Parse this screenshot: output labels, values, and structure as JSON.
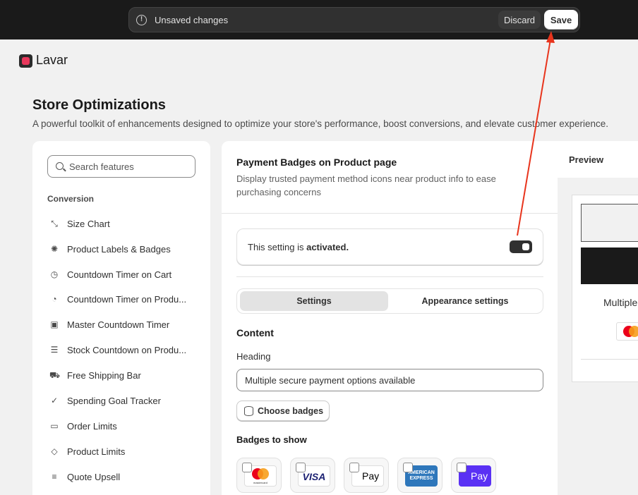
{
  "topbar": {
    "unsaved_text": "Unsaved changes",
    "discard_label": "Discard",
    "save_label": "Save"
  },
  "app": {
    "name": "Lavar"
  },
  "page": {
    "title": "Store Optimizations",
    "subtitle": "A powerful toolkit of enhancements designed to optimize your store's performance, boost conversions, and elevate customer experience."
  },
  "sidebar": {
    "search_placeholder": "Search features",
    "section": "Conversion",
    "items": [
      {
        "label": "Size Chart",
        "icon": "ruler-icon"
      },
      {
        "label": "Product Labels & Badges",
        "icon": "badge-icon"
      },
      {
        "label": "Countdown Timer on Cart",
        "icon": "clock-icon"
      },
      {
        "label": "Countdown Timer on Produ...",
        "icon": "timer-icon"
      },
      {
        "label": "Master Countdown Timer",
        "icon": "calendar-clock-icon"
      },
      {
        "label": "Stock Countdown on Produ...",
        "icon": "database-icon"
      },
      {
        "label": "Free Shipping Bar",
        "icon": "truck-icon"
      },
      {
        "label": "Spending Goal Tracker",
        "icon": "check-circle-icon"
      },
      {
        "label": "Order Limits",
        "icon": "inbox-icon"
      },
      {
        "label": "Product Limits",
        "icon": "tag-icon"
      },
      {
        "label": "Quote Upsell",
        "icon": "list-icon"
      }
    ]
  },
  "feature": {
    "title": "Payment Badges on Product page",
    "description": "Display trusted payment method icons near product info to ease purchasing concerns",
    "activation_prefix": "This setting is ",
    "activation_state": "activated.",
    "toggle_on": true,
    "tabs": {
      "settings": "Settings",
      "appearance": "Appearance settings"
    },
    "content_heading": "Content",
    "heading_label": "Heading",
    "heading_value": "Multiple secure payment options available",
    "choose_badges": "Choose badges",
    "badges_heading": "Badges to show",
    "badges": [
      {
        "name": "mastercard",
        "text": "mastercard"
      },
      {
        "name": "visa",
        "text": "VISA"
      },
      {
        "name": "apple-pay",
        "text": "Pay"
      },
      {
        "name": "american-express",
        "text": "AMERICAN EXPRESS"
      },
      {
        "name": "shop-pay",
        "text": "Pay"
      }
    ]
  },
  "preview": {
    "title": "Preview",
    "text": "Multiple"
  },
  "colors": {
    "topbar": "#1a1a1a",
    "arrow": "#e8341c",
    "brand_logo": "#e8385c"
  }
}
